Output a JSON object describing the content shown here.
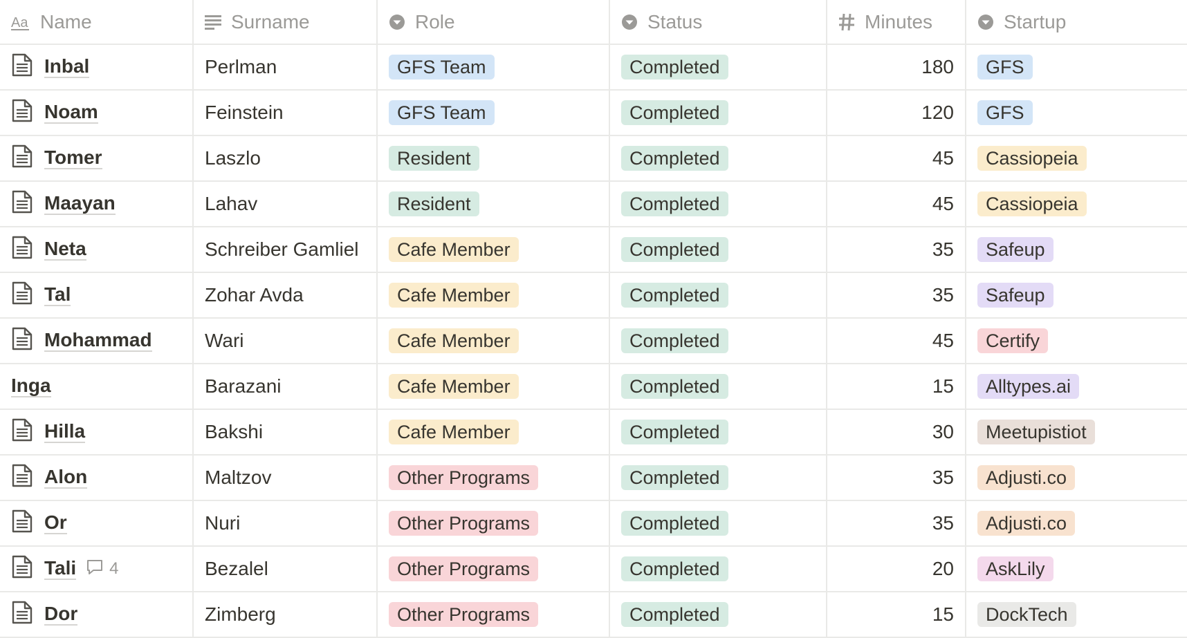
{
  "columns": {
    "name": "Name",
    "surname": "Surname",
    "role": "Role",
    "status": "Status",
    "minutes": "Minutes",
    "startup": "Startup"
  },
  "colors": {
    "GFS Team": "#d3e5f7",
    "Resident": "#d6ebe2",
    "Cafe Member": "#fbeccc",
    "Other Programs": "#f9d5d8",
    "Completed": "#d6ebe2",
    "GFS": "#d3e5f7",
    "Cassiopeia": "#fbeccc",
    "Safeup": "#e3dbf6",
    "Certify": "#f9d5d8",
    "Alltypes.ai": "#e3dbf6",
    "Meetupistiot": "#e9dfd9",
    "Adjusti.co": "#f8e2cf",
    "AskLily": "#f4d9ec",
    "DockTech": "#e9e9e7"
  },
  "rows": [
    {
      "name": "Inbal",
      "surname": "Perlman",
      "role": "GFS Team",
      "status": "Completed",
      "minutes": "180",
      "startup": "GFS",
      "icon": true,
      "comments": ""
    },
    {
      "name": "Noam",
      "surname": "Feinstein",
      "role": "GFS Team",
      "status": "Completed",
      "minutes": "120",
      "startup": "GFS",
      "icon": true,
      "comments": ""
    },
    {
      "name": "Tomer",
      "surname": "Laszlo",
      "role": "Resident",
      "status": "Completed",
      "minutes": "45",
      "startup": "Cassiopeia",
      "icon": true,
      "comments": ""
    },
    {
      "name": "Maayan",
      "surname": "Lahav",
      "role": "Resident",
      "status": "Completed",
      "minutes": "45",
      "startup": "Cassiopeia",
      "icon": true,
      "comments": ""
    },
    {
      "name": "Neta",
      "surname": "Schreiber Gamliel",
      "role": "Cafe Member",
      "status": "Completed",
      "minutes": "35",
      "startup": "Safeup",
      "icon": true,
      "comments": ""
    },
    {
      "name": "Tal",
      "surname": "Zohar Avda",
      "role": "Cafe Member",
      "status": "Completed",
      "minutes": "35",
      "startup": "Safeup",
      "icon": true,
      "comments": ""
    },
    {
      "name": "Mohammad",
      "surname": "Wari",
      "role": "Cafe Member",
      "status": "Completed",
      "minutes": "45",
      "startup": "Certify",
      "icon": true,
      "comments": ""
    },
    {
      "name": "Inga",
      "surname": "Barazani",
      "role": "Cafe Member",
      "status": "Completed",
      "minutes": "15",
      "startup": "Alltypes.ai",
      "icon": false,
      "comments": ""
    },
    {
      "name": "Hilla",
      "surname": "Bakshi",
      "role": "Cafe Member",
      "status": "Completed",
      "minutes": "30",
      "startup": "Meetupistiot",
      "icon": true,
      "comments": ""
    },
    {
      "name": "Alon",
      "surname": "Maltzov",
      "role": "Other Programs",
      "status": "Completed",
      "minutes": "35",
      "startup": "Adjusti.co",
      "icon": true,
      "comments": ""
    },
    {
      "name": "Or",
      "surname": "Nuri",
      "role": "Other Programs",
      "status": "Completed",
      "minutes": "35",
      "startup": "Adjusti.co",
      "icon": true,
      "comments": ""
    },
    {
      "name": "Tali",
      "surname": "Bezalel",
      "role": "Other Programs",
      "status": "Completed",
      "minutes": "20",
      "startup": "AskLily",
      "icon": true,
      "comments": "4"
    },
    {
      "name": "Dor",
      "surname": "Zimberg",
      "role": "Other Programs",
      "status": "Completed",
      "minutes": "15",
      "startup": "DockTech",
      "icon": true,
      "comments": ""
    }
  ]
}
